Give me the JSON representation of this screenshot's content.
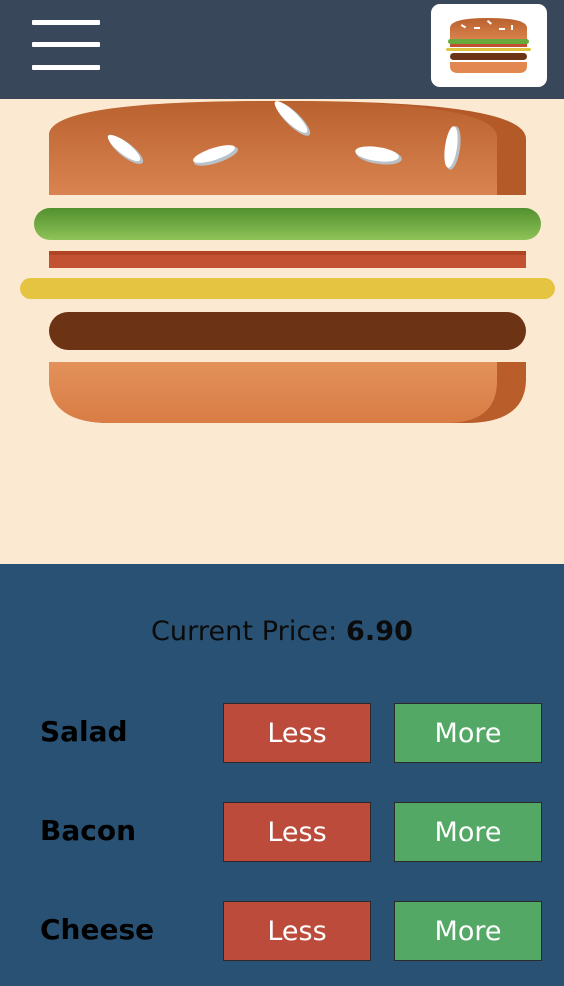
{
  "header": {
    "menu_icon": "hamburger-menu-icon",
    "logo_icon": "burger-logo-icon"
  },
  "burger": {
    "layers": [
      "bun-top",
      "salad",
      "bacon",
      "cheese",
      "patty",
      "bun-bottom"
    ]
  },
  "price": {
    "label": "Current Price: ",
    "value": "6.90"
  },
  "ingredients": [
    {
      "name": "Salad",
      "less_label": "Less",
      "more_label": "More"
    },
    {
      "name": "Bacon",
      "less_label": "Less",
      "more_label": "More"
    },
    {
      "name": "Cheese",
      "less_label": "Less",
      "more_label": "More"
    }
  ],
  "colors": {
    "header_bg": "#38485a",
    "burger_bg": "#fbead1",
    "controls_bg": "#285173",
    "less_button": "#bc4b3b",
    "more_button": "#53a866"
  }
}
